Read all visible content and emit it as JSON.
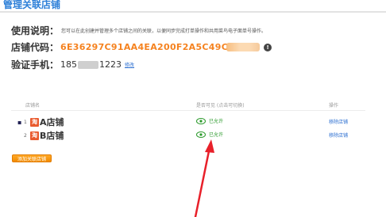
{
  "page": {
    "title": "管理关联店铺"
  },
  "intro": {
    "usage_label": "使用说明：",
    "usage_text": "您可以在此创建并管理多个店铺之间的关联，以便同步完成打单操作和共用菜鸟电子面单号操作。",
    "code_label": "店铺代码：",
    "code_value": "6E36297C91AA4EA200F2A5C49C",
    "phone_label": "验证手机：",
    "phone_prefix": "185",
    "phone_suffix": "1223",
    "modify_link": "修改"
  },
  "table": {
    "headers": [
      "店铺名",
      "是否可见 (点击可切换)",
      "操作"
    ],
    "rows": [
      {
        "bullet": "▪",
        "index": "1",
        "store_icon": "shop-icon",
        "name": "A店铺",
        "permission": "已允许",
        "action": "移除店铺"
      },
      {
        "bullet": "",
        "index": "2",
        "store_icon": "shop-icon",
        "name": "B店铺",
        "permission": "已允许",
        "action": "移除店铺"
      }
    ]
  },
  "add_button": {
    "label": "添加关联店铺"
  },
  "colors": {
    "title_blue": "#2c7fd8",
    "code_orange": "#f5821f",
    "allowed_green": "#2b9a2b",
    "link_blue": "#2c6fd1",
    "arrow_red": "#e8202a"
  }
}
